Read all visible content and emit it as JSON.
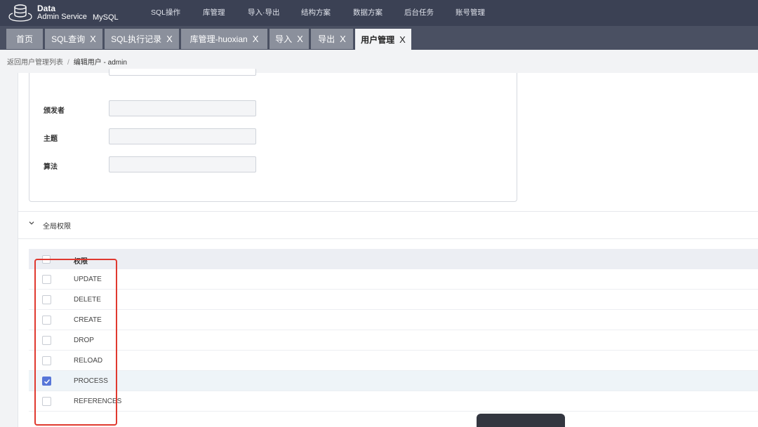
{
  "app": {
    "title_line1": "Data",
    "title_line2": "Admin Service",
    "db_type": "MySQL",
    "logo_icon": "database-icon"
  },
  "menu": [
    "SQL操作",
    "库管理",
    "导入·导出",
    "结构方案",
    "数据方案",
    "后台任务",
    "账号管理"
  ],
  "tabs": [
    {
      "label": "首页",
      "closable": false
    },
    {
      "label": "SQL查询",
      "closable": true
    },
    {
      "label": "SQL执行记录",
      "closable": true
    },
    {
      "label": "库管理-huoxian",
      "closable": true
    },
    {
      "label": "导入",
      "closable": true
    },
    {
      "label": "导出",
      "closable": true
    },
    {
      "label": "用户管理",
      "closable": true,
      "active": true
    }
  ],
  "tab_close_glyph": "X",
  "breadcrumb": {
    "back": "返回用户管理列表",
    "separator": "/",
    "current": "编辑用户 - admin"
  },
  "form": {
    "fields": [
      {
        "label": "颁发者",
        "value": ""
      },
      {
        "label": "主题",
        "value": ""
      },
      {
        "label": "算法",
        "value": ""
      }
    ]
  },
  "section": {
    "title": "全局权限",
    "icon": "chevron-down-icon"
  },
  "table": {
    "header": "权限",
    "rows": [
      {
        "name": "UPDATE",
        "checked": false
      },
      {
        "name": "DELETE",
        "checked": false
      },
      {
        "name": "CREATE",
        "checked": false
      },
      {
        "name": "DROP",
        "checked": false
      },
      {
        "name": "RELOAD",
        "checked": false
      },
      {
        "name": "PROCESS",
        "checked": true
      },
      {
        "name": "REFERENCES",
        "checked": false
      }
    ]
  },
  "colors": {
    "nav_bg": "#3b4154",
    "tabbar_bg": "#4a5062",
    "tab_bg": "#8b909c",
    "accent": "#5776d8",
    "highlight": "#e0392f"
  }
}
